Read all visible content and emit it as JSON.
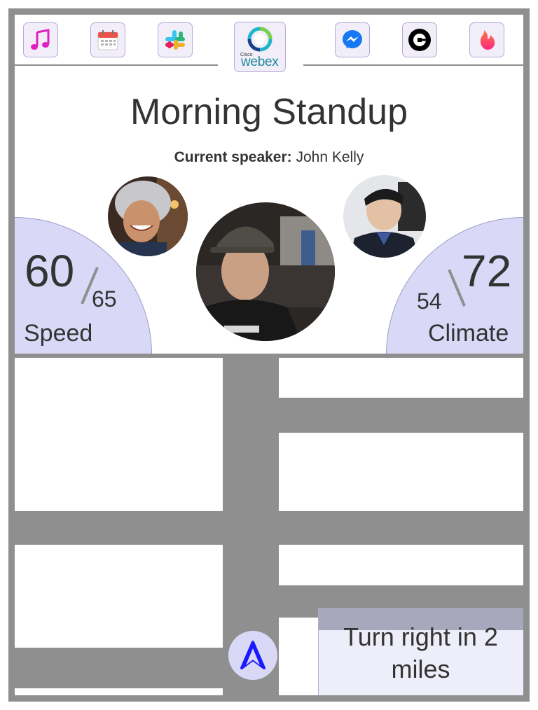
{
  "app_bar": {
    "apps": [
      {
        "name": "music-icon"
      },
      {
        "name": "calendar-icon"
      },
      {
        "name": "slack-icon"
      },
      {
        "name": "webex-icon",
        "cisco": "Cisco",
        "word": "webex"
      },
      {
        "name": "messenger-icon"
      },
      {
        "name": "uber-icon"
      },
      {
        "name": "tinder-icon"
      }
    ]
  },
  "meeting": {
    "title": "Morning Standup",
    "speaker_label": "Current speaker:",
    "speaker_name": "John Kelly"
  },
  "speed": {
    "current": "60",
    "limit": "65",
    "label": "Speed"
  },
  "climate": {
    "set": "72",
    "current": "54",
    "label": "Climate"
  },
  "navigation": {
    "instruction": "Turn right in 2 miles"
  },
  "colors": {
    "frame": "#8f8f8f",
    "gauge": "#d9d9f7",
    "app_tile": "#f1eef9",
    "nav_arrow": "#1a1aff",
    "road": "#8f8f8f"
  }
}
